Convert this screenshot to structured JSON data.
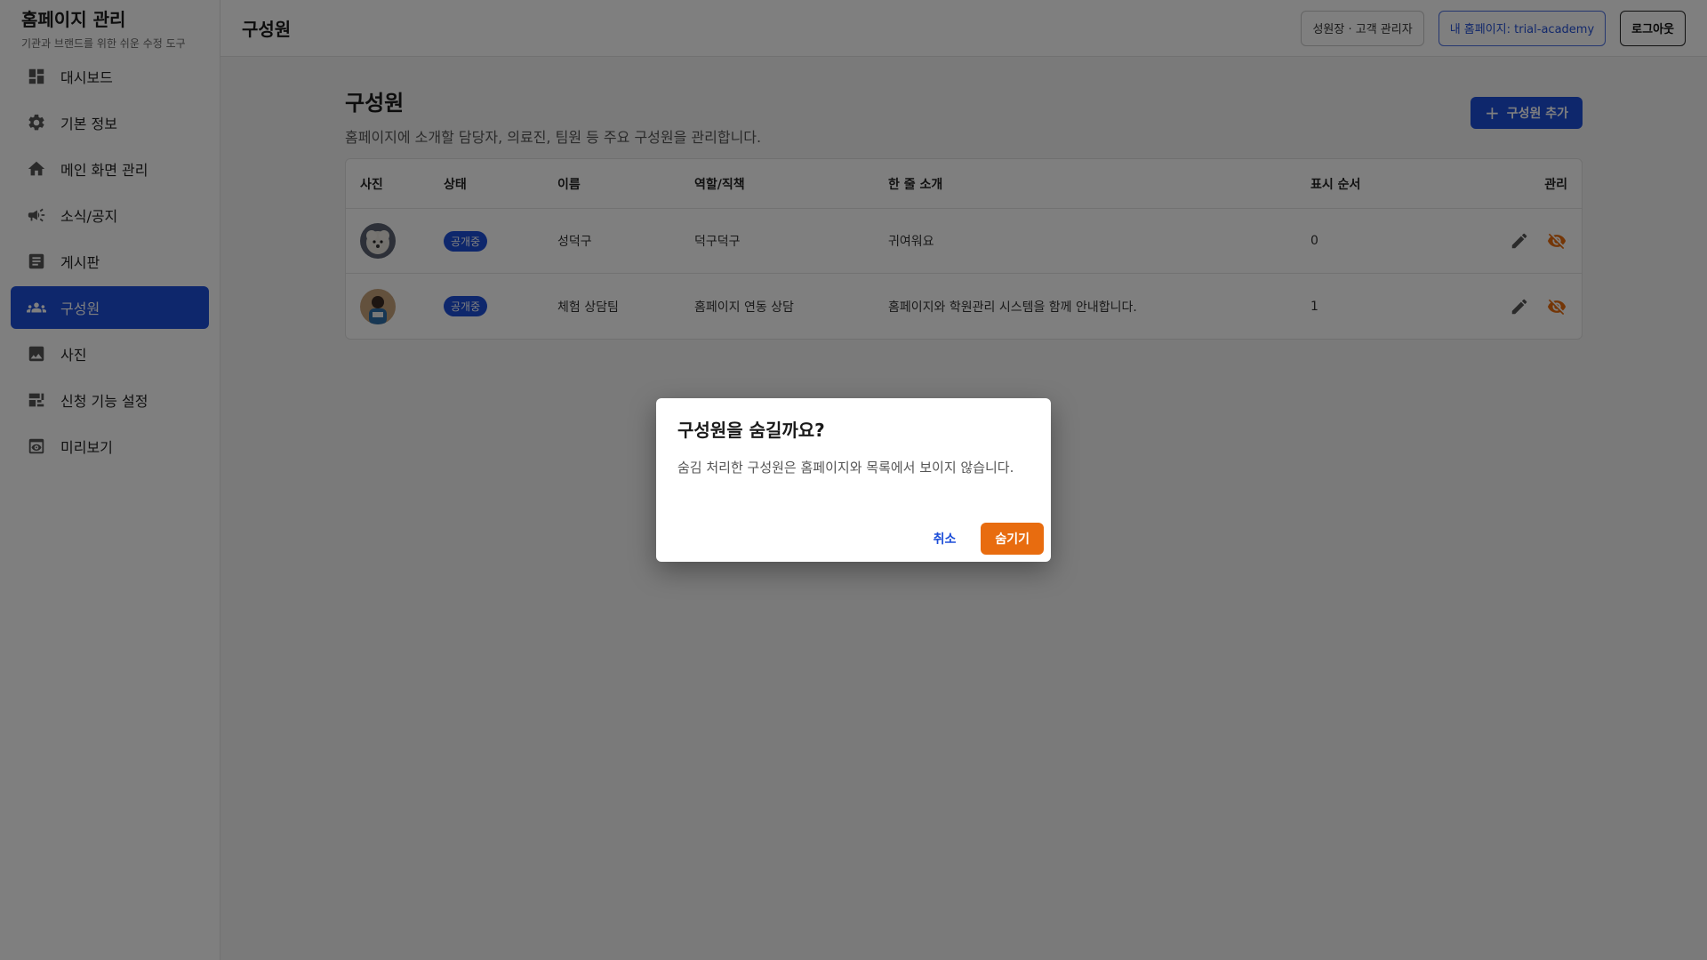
{
  "brand": {
    "title": "홈페이지 관리",
    "subtitle": "기관과 브랜드를 위한 쉬운 수정 도구"
  },
  "sidebar": {
    "items": [
      {
        "label": "대시보드",
        "icon": "dashboard-icon"
      },
      {
        "label": "기본 정보",
        "icon": "gear-icon"
      },
      {
        "label": "메인 화면 관리",
        "icon": "home-icon"
      },
      {
        "label": "소식/공지",
        "icon": "megaphone-icon"
      },
      {
        "label": "게시판",
        "icon": "article-icon"
      },
      {
        "label": "구성원",
        "icon": "people-icon",
        "active": true
      },
      {
        "label": "사진",
        "icon": "image-icon"
      },
      {
        "label": "신청 기능 설정",
        "icon": "form-settings-icon"
      },
      {
        "label": "미리보기",
        "icon": "preview-icon"
      }
    ]
  },
  "topbar": {
    "title": "구성원",
    "role_label": "성원장 · 고객 관리자",
    "homepage_label": "내 홈페이지: trial-academy",
    "logout_label": "로그아웃"
  },
  "page": {
    "title": "구성원",
    "description": "홈페이지에 소개할 담당자, 의료진, 팀원 등 주요 구성원을 관리합니다.",
    "add_button": "구성원 추가",
    "add_button_icon": "plus-icon"
  },
  "table": {
    "headers": {
      "photo": "사진",
      "status": "상태",
      "name": "이름",
      "role": "역할/직책",
      "intro": "한 줄 소개",
      "order": "표시 순서",
      "manage": "관리"
    },
    "rows": [
      {
        "status": "공개중",
        "name": "성덕구",
        "role": "덕구덕구",
        "intro": "귀여워요",
        "order": "0"
      },
      {
        "status": "공개중",
        "name": "체험 상담팀",
        "role": "홈페이지 연동 상담",
        "intro": "홈페이지와 학원관리 시스템을 함께 안내합니다.",
        "order": "1"
      }
    ]
  },
  "dialog": {
    "title": "구성원을 숨길까요?",
    "body": "숨김 처리한 구성원은 홈페이지와 목록에서 보이지 않습니다.",
    "cancel_label": "취소",
    "confirm_label": "숨기기"
  },
  "colors": {
    "primary": "#1d4ed8",
    "warning": "#e86c0f",
    "overlay": "rgba(0,0,0,0.5)"
  }
}
